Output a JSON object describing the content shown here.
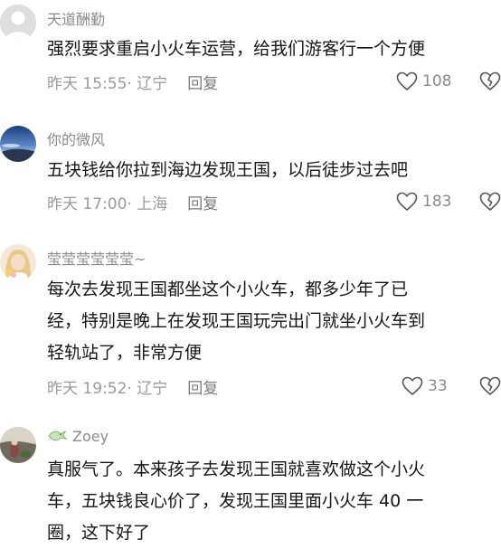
{
  "comments": [
    {
      "username": "天道酬勤",
      "text": "强烈要求重启小火车运营，给我们游客行一个方便",
      "time": "昨天 15:55",
      "location": "· 辽宁",
      "reply_label": "回复",
      "likes": "108"
    },
    {
      "username": "你的微风",
      "text": "五块钱给你拉到海边发现王国，以后徒步过去吧",
      "time": "昨天 17:00",
      "location": "· 上海",
      "reply_label": "回复",
      "likes": "183"
    },
    {
      "username": "莹莹莹莹莹莹~",
      "text": "每次去发现王国都坐这个小火车，都多少年了已\n经，特别是晚上在发现王国玩完出门就坐小火车到\n轻轨站了，非常方便",
      "time": "昨天 19:52",
      "location": "· 辽宁",
      "reply_label": "回复",
      "likes": "33"
    },
    {
      "username": "Zoey",
      "text": "真服气了。本来孩子去发现王国就喜欢做这个小火\n车，五块钱良心价了，发现王国里面小火车 40 一\n圈，这下好了",
      "time": "",
      "location": "",
      "reply_label": "",
      "likes": ""
    }
  ],
  "icons": {
    "like": "heart-outline-icon",
    "dislike": "broken-heart-icon",
    "zoey_badge": "dove-icon"
  },
  "colors": {
    "username": "#8a8a8a",
    "text": "#161616",
    "meta": "#9a9a9a"
  }
}
